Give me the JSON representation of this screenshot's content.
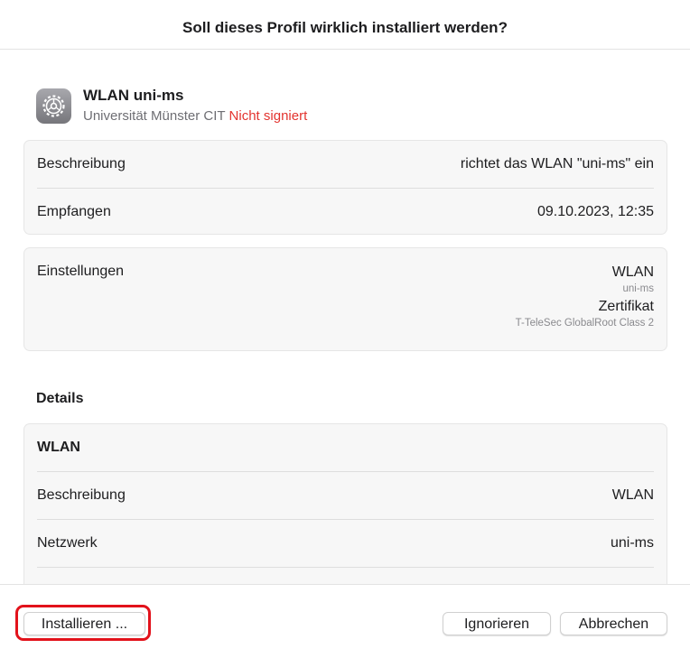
{
  "dialog": {
    "title": "Soll dieses Profil wirklich installiert werden?"
  },
  "profile": {
    "icon": "settings-gear-icon",
    "name": "WLAN uni-ms",
    "organization": "Universität Münster CIT",
    "signature_status": "Nicht signiert",
    "signature_color": "#e3342f"
  },
  "summary": {
    "rows": [
      {
        "label": "Beschreibung",
        "value": "richtet das WLAN \"uni-ms\" ein"
      },
      {
        "label": "Empfangen",
        "value": "09.10.2023, 12:35"
      }
    ]
  },
  "settings": {
    "label": "Einstellungen",
    "items": [
      {
        "title": "WLAN",
        "subtitle": "uni-ms"
      },
      {
        "title": "Zertifikat",
        "subtitle": "T-TeleSec GlobalRoot Class 2"
      }
    ]
  },
  "details": {
    "heading": "Details",
    "section_title": "WLAN",
    "rows": [
      {
        "label": "Beschreibung",
        "value": "WLAN"
      },
      {
        "label": "Netzwerk",
        "value": "uni-ms"
      }
    ]
  },
  "buttons": {
    "install": "Installieren ...",
    "ignore": "Ignorieren",
    "cancel": "Abbrechen"
  },
  "annotation": {
    "highlight_color": "#e2121b"
  }
}
